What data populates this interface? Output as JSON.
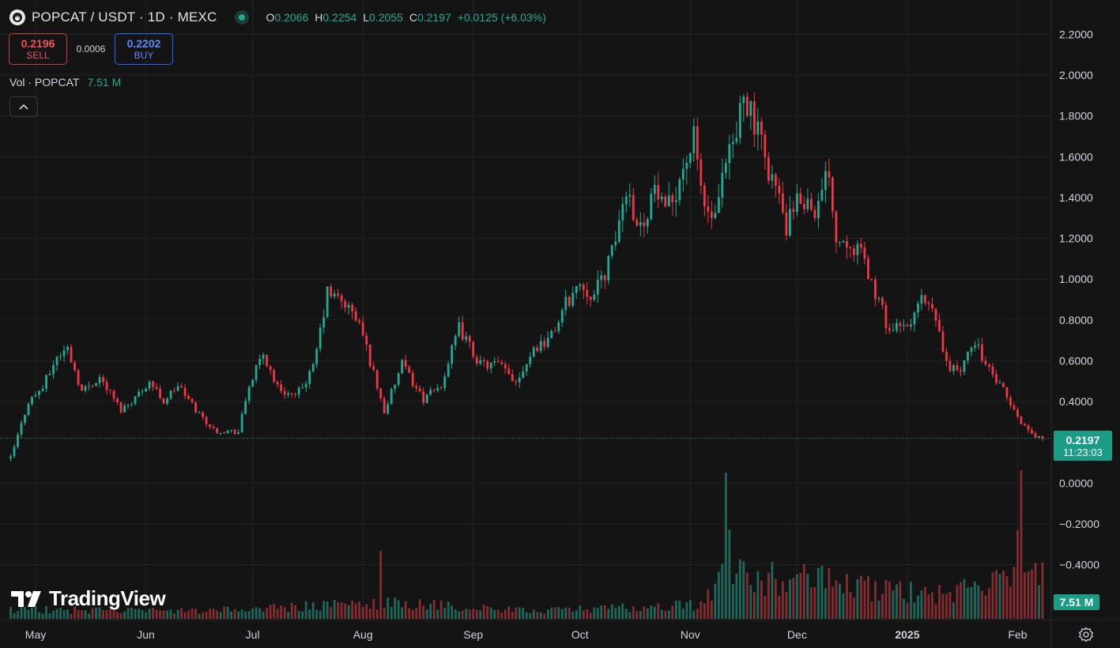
{
  "header": {
    "symbol_title": "POPCAT / USDT · 1D · MEXC",
    "symbol_icon": "popcat-logo-icon",
    "ohlc": [
      {
        "key": "O",
        "value": "0.2066"
      },
      {
        "key": "H",
        "value": "0.2254"
      },
      {
        "key": "L",
        "value": "0.2055"
      },
      {
        "key": "C",
        "value": "0.2197"
      }
    ],
    "change": "+0.0125 (+6.03%)"
  },
  "trade": {
    "sell_price": "0.2196",
    "sell_label": "SELL",
    "spread": "0.0006",
    "buy_price": "0.2202",
    "buy_label": "BUY"
  },
  "volume_legend": {
    "label": "Vol · POPCAT",
    "value": "7.51 M"
  },
  "price_tag": {
    "price": "0.2197",
    "countdown": "11:23:03"
  },
  "volume_tag": "7.51 M",
  "logo_text": "TradingView",
  "colors": {
    "up": "#22ab94",
    "down": "#f23645",
    "background": "#141414",
    "grid": "#232323",
    "price_line": "#22ab94"
  },
  "chart_data": {
    "type": "candlestick",
    "title": "POPCAT / USDT · 1D · MEXC",
    "y_axis": {
      "labels": [
        "2.2000",
        "2.0000",
        "1.8000",
        "1.6000",
        "1.4000",
        "1.2000",
        "1.0000",
        "0.8000",
        "0.6000",
        "0.4000",
        "0.0000",
        "−0.2000",
        "−0.4000"
      ],
      "range": [
        -0.6,
        2.25
      ]
    },
    "x_axis": {
      "labels": [
        "May",
        "Jun",
        "Jul",
        "Aug",
        "Sep",
        "Oct",
        "Nov",
        "Dec",
        "2025",
        "Feb"
      ],
      "range": [
        "2024-04-21",
        "2025-02-10"
      ]
    },
    "last_price": 0.2197,
    "series": [
      {
        "name": "POPCAT / USDT",
        "kind": "close_path",
        "points": [
          [
            "2024-04-24",
            0.12
          ],
          [
            "2024-04-29",
            0.4
          ],
          [
            "2024-05-03",
            0.47
          ],
          [
            "2024-05-07",
            0.62
          ],
          [
            "2024-05-10",
            0.66
          ],
          [
            "2024-05-14",
            0.45
          ],
          [
            "2024-05-19",
            0.52
          ],
          [
            "2024-05-25",
            0.36
          ],
          [
            "2024-05-29",
            0.42
          ],
          [
            "2024-06-02",
            0.5
          ],
          [
            "2024-06-06",
            0.4
          ],
          [
            "2024-06-10",
            0.48
          ],
          [
            "2024-06-15",
            0.36
          ],
          [
            "2024-06-20",
            0.26
          ],
          [
            "2024-06-27",
            0.25
          ],
          [
            "2024-06-30",
            0.48
          ],
          [
            "2024-07-04",
            0.63
          ],
          [
            "2024-07-08",
            0.47
          ],
          [
            "2024-07-13",
            0.42
          ],
          [
            "2024-07-18",
            0.56
          ],
          [
            "2024-07-22",
            0.93
          ],
          [
            "2024-07-27",
            0.88
          ],
          [
            "2024-07-31",
            0.78
          ],
          [
            "2024-08-03",
            0.6
          ],
          [
            "2024-08-07",
            0.35
          ],
          [
            "2024-08-12",
            0.58
          ],
          [
            "2024-08-18",
            0.41
          ],
          [
            "2024-08-23",
            0.48
          ],
          [
            "2024-08-28",
            0.76
          ],
          [
            "2024-09-03",
            0.58
          ],
          [
            "2024-09-08",
            0.58
          ],
          [
            "2024-09-13",
            0.5
          ],
          [
            "2024-09-18",
            0.66
          ],
          [
            "2024-09-23",
            0.72
          ],
          [
            "2024-09-27",
            0.88
          ],
          [
            "2024-10-01",
            0.98
          ],
          [
            "2024-10-05",
            0.92
          ],
          [
            "2024-10-10",
            1.12
          ],
          [
            "2024-10-14",
            1.45
          ],
          [
            "2024-10-18",
            1.25
          ],
          [
            "2024-10-22",
            1.45
          ],
          [
            "2024-10-25",
            1.3
          ],
          [
            "2024-10-30",
            1.55
          ],
          [
            "2024-11-02",
            1.68
          ],
          [
            "2024-11-05",
            1.35
          ],
          [
            "2024-11-08",
            1.28
          ],
          [
            "2024-11-11",
            1.55
          ],
          [
            "2024-11-14",
            1.7
          ],
          [
            "2024-11-16",
            1.95
          ],
          [
            "2024-11-19",
            1.75
          ],
          [
            "2024-11-22",
            1.6
          ],
          [
            "2024-11-25",
            1.45
          ],
          [
            "2024-11-28",
            1.25
          ],
          [
            "2024-12-02",
            1.4
          ],
          [
            "2024-12-07",
            1.35
          ],
          [
            "2024-12-10",
            1.55
          ],
          [
            "2024-12-12",
            1.2
          ],
          [
            "2024-12-16",
            1.2
          ],
          [
            "2024-12-20",
            1.08
          ],
          [
            "2024-12-24",
            0.88
          ],
          [
            "2024-12-27",
            0.75
          ],
          [
            "2025-01-01",
            0.76
          ],
          [
            "2025-01-05",
            0.9
          ],
          [
            "2025-01-09",
            0.8
          ],
          [
            "2025-01-12",
            0.58
          ],
          [
            "2025-01-16",
            0.55
          ],
          [
            "2025-01-20",
            0.7
          ],
          [
            "2025-01-24",
            0.55
          ],
          [
            "2025-01-28",
            0.45
          ],
          [
            "2025-02-01",
            0.32
          ],
          [
            "2025-02-05",
            0.24
          ],
          [
            "2025-02-08",
            0.2197
          ]
        ]
      },
      {
        "name": "Vol · POPCAT",
        "kind": "volume",
        "unit": "M",
        "baseline_points": [
          [
            "2024-04-24",
            1.8
          ],
          [
            "2024-06-15",
            1.4
          ],
          [
            "2024-07-25",
            2.6
          ],
          [
            "2024-08-10",
            3.0
          ],
          [
            "2024-09-15",
            1.5
          ],
          [
            "2024-10-20",
            2.2
          ],
          [
            "2024-11-05",
            2.8
          ],
          [
            "2024-11-12",
            12.0
          ],
          [
            "2024-11-20",
            8.0
          ],
          [
            "2024-12-05",
            7.5
          ],
          [
            "2024-12-25",
            5.5
          ],
          [
            "2025-01-10",
            4.5
          ],
          [
            "2025-01-25",
            6.5
          ],
          [
            "2025-02-08",
            9.0
          ]
        ],
        "spikes": [
          [
            "2024-08-06",
            13.0
          ],
          [
            "2024-11-11",
            28.0
          ],
          [
            "2024-11-16",
            11.0
          ],
          [
            "2025-02-02",
            28.5
          ],
          [
            "2025-02-01",
            17.0
          ]
        ]
      }
    ]
  }
}
